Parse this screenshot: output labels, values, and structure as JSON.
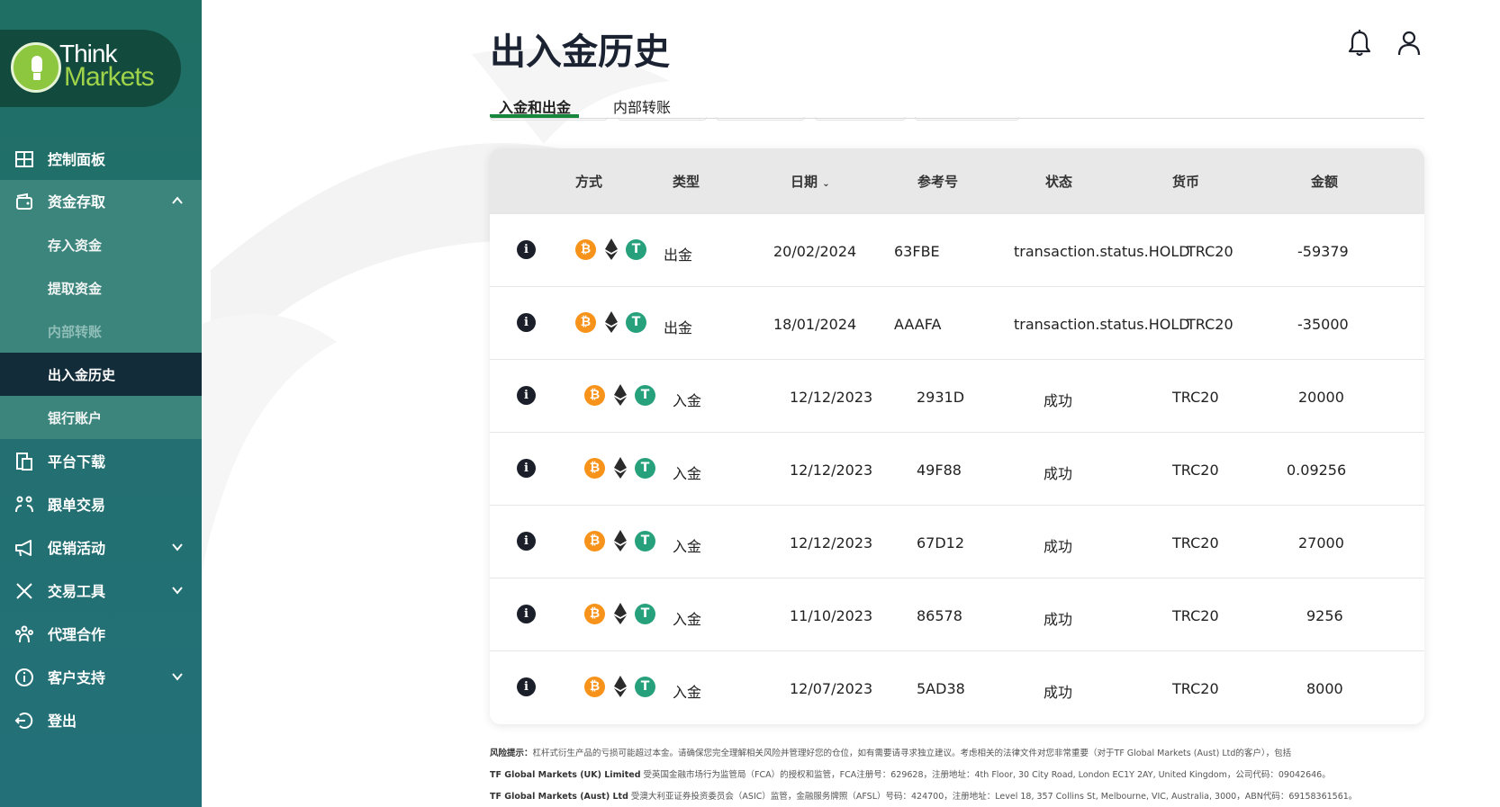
{
  "brand": {
    "line1": "Think",
    "line2": "Markets"
  },
  "sidebar": {
    "items": [
      {
        "label": "控制面板",
        "icon": "dashboard-icon"
      },
      {
        "label": "资金存取",
        "icon": "wallet-icon"
      },
      {
        "label": "平台下载",
        "icon": "download-platform-icon"
      },
      {
        "label": "跟单交易",
        "icon": "copy-trading-icon"
      },
      {
        "label": "促销活动",
        "icon": "megaphone-icon"
      },
      {
        "label": "交易工具",
        "icon": "tools-icon"
      },
      {
        "label": "代理合作",
        "icon": "partners-icon"
      },
      {
        "label": "客户支持",
        "icon": "info-icon"
      },
      {
        "label": "登出",
        "icon": "logout-icon"
      }
    ],
    "submenu": [
      {
        "label": "存入资金"
      },
      {
        "label": "提取资金"
      },
      {
        "label": "内部转账"
      },
      {
        "label": "出入金历史"
      },
      {
        "label": "银行账户"
      }
    ]
  },
  "page": {
    "title": "出入金历史"
  },
  "tabs": [
    {
      "label": "入金和出金"
    },
    {
      "label": "内部转账"
    }
  ],
  "table": {
    "headers": {
      "method": "方式",
      "type": "类型",
      "date": "日期",
      "ref": "参考号",
      "status": "状态",
      "currency": "货币",
      "amount": "金额"
    },
    "rows": [
      {
        "type": "出金",
        "date": "20/02/2024",
        "ref": "63FBE",
        "status": "transaction.status.HOLD",
        "currency": "TRC20",
        "amount": "-59379"
      },
      {
        "type": "出金",
        "date": "18/01/2024",
        "ref": "AAAFA",
        "status": "transaction.status.HOLD",
        "currency": "TRC20",
        "amount": "-35000"
      },
      {
        "type": "入金",
        "date": "12/12/2023",
        "ref": "2931D",
        "status": "成功",
        "currency": "TRC20",
        "amount": "20000"
      },
      {
        "type": "入金",
        "date": "12/12/2023",
        "ref": "49F88",
        "status": "成功",
        "currency": "TRC20",
        "amount": "0.09256"
      },
      {
        "type": "入金",
        "date": "12/12/2023",
        "ref": "67D12",
        "status": "成功",
        "currency": "TRC20",
        "amount": "27000"
      },
      {
        "type": "入金",
        "date": "11/10/2023",
        "ref": "86578",
        "status": "成功",
        "currency": "TRC20",
        "amount": "9256"
      },
      {
        "type": "入金",
        "date": "12/07/2023",
        "ref": "5AD38",
        "status": "成功",
        "currency": "TRC20",
        "amount": "8000"
      }
    ]
  },
  "footer": {
    "line1_bold": "风险提示：",
    "line1": "杠杆式衍生产品的亏损可能超过本金。请确保您完全理解相关风险并管理好您的仓位，如有需要请寻求独立建议。考虑相关的法律文件对您非常重要（对于TF Global Markets (Aust) Ltd的客户），包括",
    "line2_bold": "TF Global Markets (UK) Limited",
    "line2": "受英国金融市场行为监管局（FCA）的授权和监管，FCA注册号：629628，注册地址：4th Floor, 30 City Road, London EC1Y 2AY, United Kingdom，公司代码：09042646。",
    "line3_bold": "TF Global Markets (Aust) Ltd",
    "line3": "受澳大利亚证券投资委员会（ASIC）监管，金融服务牌照（AFSL）号码：424700，注册地址：Level 18, 357 Collins St, Melbourne, VIC, Australia, 3000，ABN代码：69158361561。"
  },
  "colors": {
    "sidebar": "#1f6f64",
    "active_nav": "#132c39",
    "accent_green": "#16873b",
    "btc": "#f7931a",
    "usdt": "#26a17b"
  }
}
